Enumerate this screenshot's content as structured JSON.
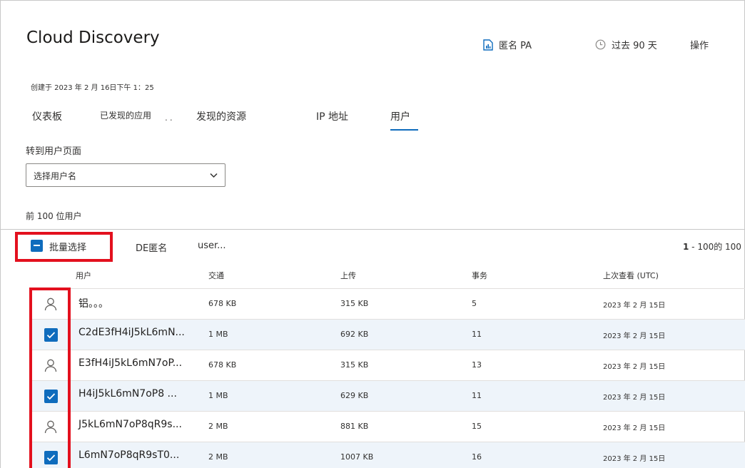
{
  "header": {
    "title": "Cloud Discovery",
    "anon_label": "匿名 PA",
    "time_label": "过去 90 天",
    "actions_label": "操作",
    "created": "创建于 2023 年 2 月 16日下午 1：25"
  },
  "tabs": [
    {
      "label": "仪表板"
    },
    {
      "label": "已发现的应用"
    },
    {
      "label": "发现的资源"
    },
    {
      "label": "IP 地址"
    },
    {
      "label": "用户",
      "active": true
    }
  ],
  "tabs_more": "..",
  "goto": {
    "label": "转到用户页面",
    "select_value": "选择用户名"
  },
  "top_users_label": "前 100 位用户",
  "toolbar": {
    "bulk_label": "批量选择",
    "anon_label": "DE匿名",
    "user_label": "user...",
    "pager_range": "1",
    "pager_rest": " - 100的 100"
  },
  "columns": {
    "user": "用户",
    "traffic": "交通",
    "upload": "上传",
    "transactions": "事务",
    "last_seen": "上次查看 (UTC)"
  },
  "rows": [
    {
      "name": "铝。。。",
      "traffic": "678 KB",
      "upload": "315 KB",
      "transactions": "5",
      "last_seen": "2023 年 2 月 15日",
      "selected": false
    },
    {
      "name": "C2dE3fH4iJ5kL6mN...",
      "traffic": "1 MB",
      "upload": "692 KB",
      "transactions": "11",
      "last_seen": "2023 年 2 月 15日",
      "selected": true
    },
    {
      "name": "E3fH4iJ5kL6mN7oP...",
      "traffic": "678 KB",
      "upload": "315 KB",
      "transactions": "13",
      "last_seen": "2023 年 2 月 15日",
      "selected": false
    },
    {
      "name": "H4iJ5kL6mN7oP8 ...",
      "traffic": "1 MB",
      "upload": "629 KB",
      "transactions": "11",
      "last_seen": "2023 年 2 月 15日",
      "selected": true
    },
    {
      "name": "J5kL6mN7oP8qR9s...",
      "traffic": "2 MB",
      "upload": "881 KB",
      "transactions": "15",
      "last_seen": "2023 年 2 月 15日",
      "selected": false
    },
    {
      "name": "L6mN7oP8qR9sT0...",
      "traffic": "2 MB",
      "upload": "1007 KB",
      "transactions": "16",
      "last_seen": "2023 年 2 月 15日",
      "selected": true
    }
  ],
  "colors": {
    "accent": "#0f6cbd",
    "highlight": "#e3101e",
    "selected_row": "#eef4fa"
  }
}
